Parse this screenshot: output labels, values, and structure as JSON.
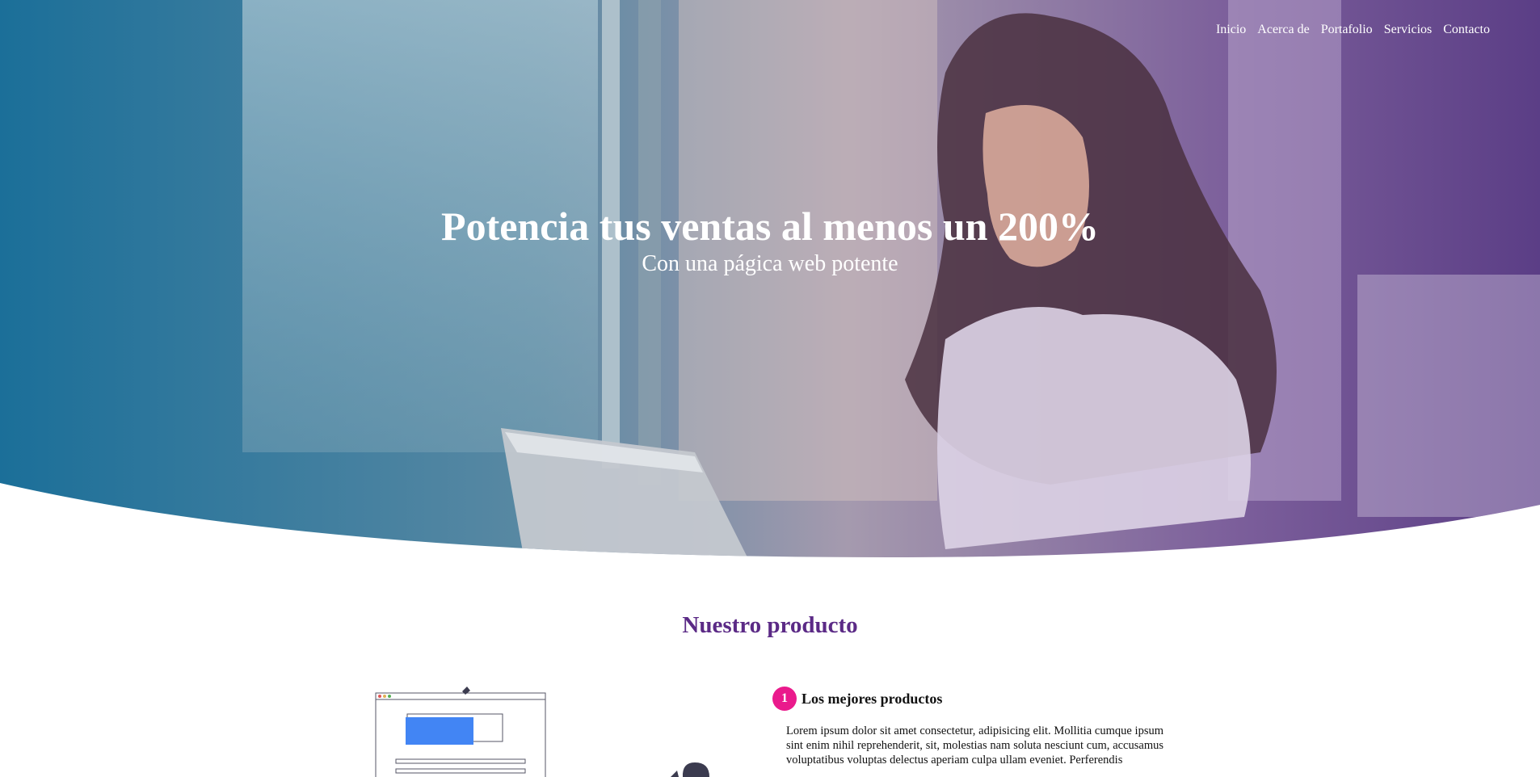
{
  "nav": {
    "items": [
      "Inicio",
      "Acerca de",
      "Portafolio",
      "Servicios",
      "Contacto"
    ]
  },
  "hero": {
    "title": "Potencia tus ventas al menos un 200%",
    "subtitle": "Con una págica web potente"
  },
  "product": {
    "section_title": "Nuestro producto",
    "feature_number": "1",
    "feature_title": "Los mejores productos",
    "feature_body": "Lorem ipsum dolor sit amet consectetur, adipisicing elit. Mollitia cumque ipsum sint enim nihil reprehenderit, sit, molestias nam soluta nesciunt cum, accusamus voluptatibus voluptas delectus aperiam culpa ullam eveniet. Perferendis"
  },
  "colors": {
    "gradient_left": "#1b6f99",
    "gradient_right": "#5b3e86",
    "heading": "#5b2a86",
    "accent": "#ea1a8c"
  }
}
